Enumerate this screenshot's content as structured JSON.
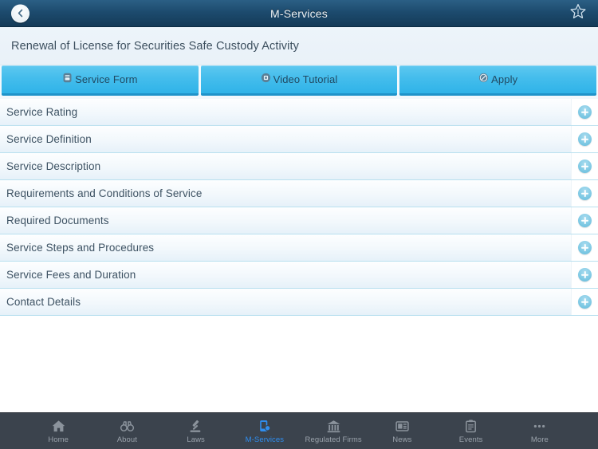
{
  "navbar": {
    "title": "M-Services",
    "back_icon": "chevron-left-icon",
    "favorite_icon": "star-outline-icon"
  },
  "heading": {
    "text": "Renewal of License for Securities Safe Custody Activity"
  },
  "tabstrip": {
    "items": [
      {
        "label": "Service Form",
        "icon": "document-icon"
      },
      {
        "label": "Video Tutorial",
        "icon": "video-icon"
      },
      {
        "label": "Apply",
        "icon": "edit-circle-icon"
      }
    ]
  },
  "list": {
    "rows": [
      {
        "label": "Service Rating",
        "action_icon": "plus-icon"
      },
      {
        "label": "Service Definition",
        "action_icon": "plus-icon"
      },
      {
        "label": "Service Description",
        "action_icon": "plus-icon"
      },
      {
        "label": "Requirements and Conditions of Service",
        "action_icon": "plus-icon"
      },
      {
        "label": "Required Documents",
        "action_icon": "plus-icon"
      },
      {
        "label": "Service Steps and Procedures",
        "action_icon": "plus-icon"
      },
      {
        "label": "Service Fees and Duration",
        "action_icon": "plus-icon"
      },
      {
        "label": "Contact Details",
        "action_icon": "plus-icon"
      }
    ]
  },
  "tabbar": {
    "active_index": 3,
    "active_color": "#2f8ef0",
    "inactive_color": "#9aa2ab",
    "items": [
      {
        "label": "Home",
        "icon": "home-icon"
      },
      {
        "label": "About",
        "icon": "binoculars-icon"
      },
      {
        "label": "Laws",
        "icon": "gavel-icon"
      },
      {
        "label": "M-Services",
        "icon": "mobile-service-icon"
      },
      {
        "label": "Regulated Firms",
        "icon": "bank-icon"
      },
      {
        "label": "News",
        "icon": "newspaper-icon"
      },
      {
        "label": "Events",
        "icon": "clipboard-icon"
      },
      {
        "label": "More",
        "icon": "ellipsis-icon"
      }
    ]
  }
}
